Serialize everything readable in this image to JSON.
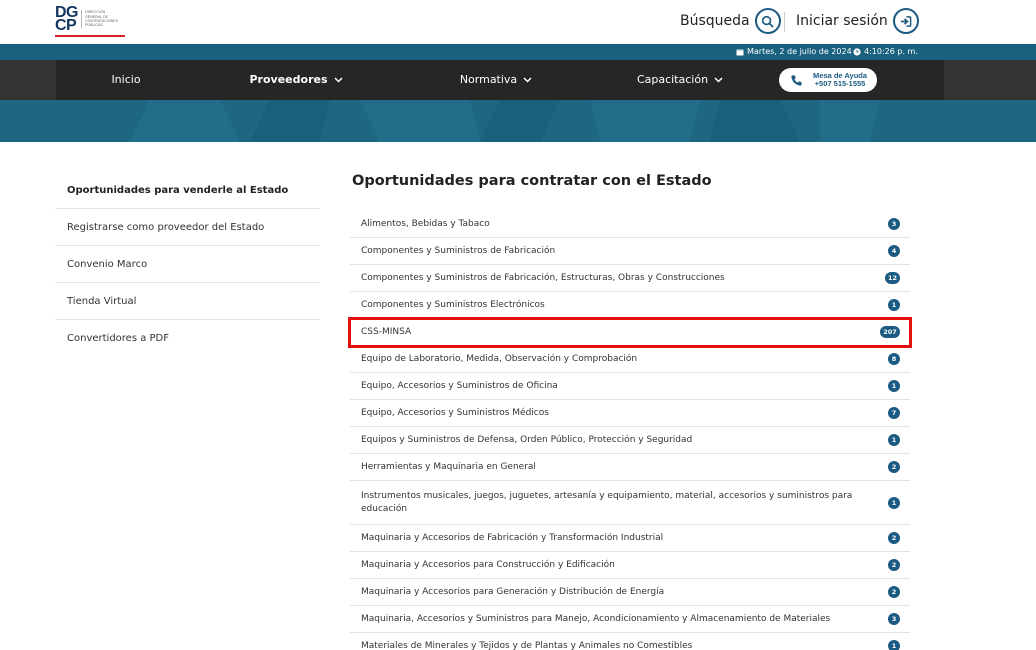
{
  "logo": {
    "mark_top": "DG",
    "mark_bottom": "CP",
    "text_lines": [
      "DIRECCIÓN",
      "GENERAL DE",
      "CONTRATACIONES",
      "PÚBLICAS"
    ],
    "brand_color": "#14355f",
    "accent_color": "#d4232a"
  },
  "header": {
    "search_label": "Búsqueda",
    "login_label": "Iniciar sesión"
  },
  "datebar": {
    "date": "Martes, 2 de julio de 2024",
    "time": "4:10:26 p. m.",
    "bg_color": "#19617f"
  },
  "nav": {
    "items": [
      {
        "label": "Inicio"
      },
      {
        "label": "Proveedores"
      },
      {
        "label": "Normativa"
      },
      {
        "label": "Capacitación"
      }
    ],
    "help_line1": "Mesa de Ayuda",
    "help_line2": "+507 515-1555"
  },
  "sidebar": {
    "items": [
      {
        "label": "Oportunidades para venderle al Estado"
      },
      {
        "label": "Registrarse como proveedor del Estado"
      },
      {
        "label": "Convenio Marco"
      },
      {
        "label": "Tienda Virtual"
      },
      {
        "label": "Convertidores a PDF"
      }
    ]
  },
  "main": {
    "title": "Oportunidades para contratar con el Estado",
    "categories": [
      {
        "label": "Alimentos, Bebidas y Tabaco",
        "count": "3"
      },
      {
        "label": "Componentes y Suministros de Fabricación",
        "count": "4"
      },
      {
        "label": "Componentes y Suministros de Fabricación, Estructuras, Obras y Construcciones",
        "count": "12"
      },
      {
        "label": "Componentes y Suministros Electrónicos",
        "count": "1"
      },
      {
        "label": "CSS-MINSA",
        "count": "207"
      },
      {
        "label": "Equipo de Laboratorio, Medida, Observación y Comprobación",
        "count": "8"
      },
      {
        "label": "Equipo, Accesorios y Suministros de Oficina",
        "count": "1"
      },
      {
        "label": "Equipo, Accesorios y Suministros Médicos",
        "count": "7"
      },
      {
        "label": "Equipos y Suministros de Defensa, Orden Público, Protección y Seguridad",
        "count": "1"
      },
      {
        "label": "Herramientas y Maquinaria en General",
        "count": "2"
      },
      {
        "label": "Instrumentos musicales, juegos, juguetes, artesanía y equipamiento, material, accesorios y suministros para educación",
        "count": "1"
      },
      {
        "label": "Maquinaria y Accesorios de Fabricación y Transformación Industrial",
        "count": "2"
      },
      {
        "label": "Maquinaria y Accesorios para Construcción y Edificación",
        "count": "2"
      },
      {
        "label": "Maquinaria y Accesorios para Generación y Distribución de Energía",
        "count": "2"
      },
      {
        "label": "Maquinaria, Accesorios y Suministros para Manejo, Acondicionamiento y Almacenamiento de Materiales",
        "count": "3"
      },
      {
        "label": "Materiales de Minerales y Tejidos y de Plantas y Animales no Comestibles",
        "count": "1"
      }
    ]
  },
  "colors": {
    "nav_bg": "#262626",
    "badge": "#1b5a82",
    "highlight": "#e10f0f"
  }
}
